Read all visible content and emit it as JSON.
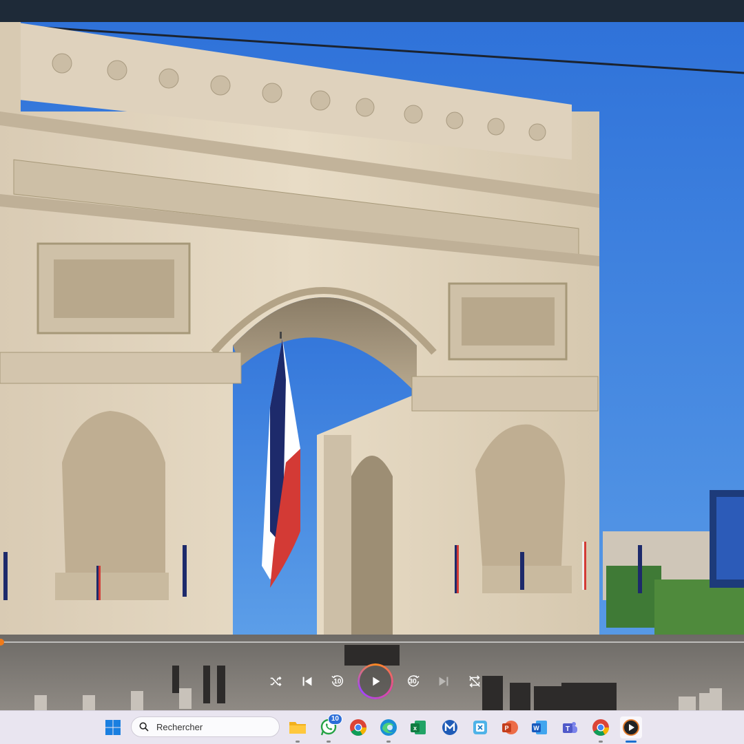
{
  "window": {
    "title_bar_color": "#1e2a38"
  },
  "video": {
    "subject": "Arc de Triomphe with French flag",
    "progress": 0.0
  },
  "player": {
    "controls": [
      {
        "name": "shuffle-button",
        "icon": "shuffle-icon",
        "enabled": true
      },
      {
        "name": "previous-button",
        "icon": "skip-previous-icon",
        "enabled": true
      },
      {
        "name": "rewind-10-button",
        "icon": "rewind-icon",
        "label": "10",
        "enabled": true
      },
      {
        "name": "play-button",
        "icon": "play-icon",
        "enabled": true
      },
      {
        "name": "forward-30-button",
        "icon": "fast-forward-icon",
        "label": "30",
        "enabled": true
      },
      {
        "name": "next-button",
        "icon": "skip-next-icon",
        "enabled": false
      },
      {
        "name": "repeat-button",
        "icon": "repeat-off-icon",
        "enabled": true
      }
    ],
    "accent_color": "#f07a1a"
  },
  "taskbar": {
    "search_placeholder": "Rechercher",
    "whatsapp_badge": "10",
    "apps": [
      {
        "name": "windows-start",
        "icon": "windows-logo-icon"
      },
      {
        "name": "file-explorer",
        "icon": "folder-icon",
        "running": true
      },
      {
        "name": "whatsapp",
        "icon": "whatsapp-icon",
        "running": true
      },
      {
        "name": "chrome",
        "icon": "chrome-icon"
      },
      {
        "name": "edge",
        "icon": "edge-icon",
        "running": true
      },
      {
        "name": "excel",
        "icon": "excel-icon"
      },
      {
        "name": "malwarebytes",
        "icon": "m-app-icon"
      },
      {
        "name": "snipping-tool",
        "icon": "snip-icon"
      },
      {
        "name": "powerpoint",
        "icon": "powerpoint-icon"
      },
      {
        "name": "word",
        "icon": "word-icon"
      },
      {
        "name": "teams",
        "icon": "teams-icon"
      },
      {
        "name": "chrome-2",
        "icon": "chrome-icon",
        "running": true
      },
      {
        "name": "media-player",
        "icon": "media-player-icon",
        "running": true,
        "active": true
      }
    ]
  }
}
